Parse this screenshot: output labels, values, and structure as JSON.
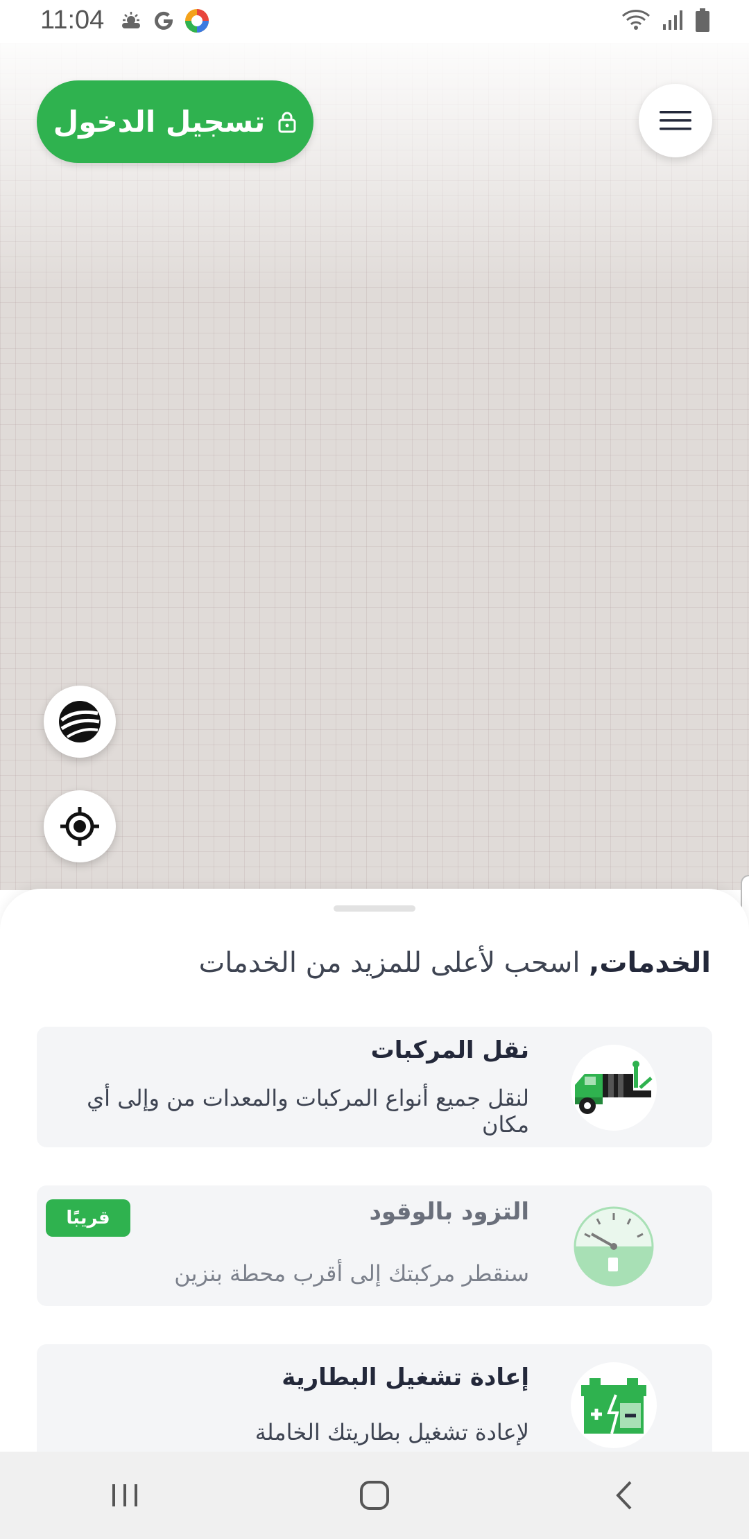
{
  "status_bar": {
    "time": "11:04",
    "left_icons": [
      "weather-icon",
      "google-icon",
      "app-icon"
    ],
    "right_icons": [
      "wifi-icon",
      "signal-icon",
      "battery-icon"
    ]
  },
  "header": {
    "login_label": "تسجيل الدخول",
    "login_icon": "lock-icon",
    "menu_icon": "hamburger-menu-icon"
  },
  "map": {
    "controls": [
      "map-layers-icon",
      "my-location-icon"
    ]
  },
  "sheet": {
    "title_bold": "الخدمات,",
    "title_rest": " اسحب لأعلى للمزيد من الخدمات",
    "services": [
      {
        "title": "نقل المركبات",
        "description": "لنقل جميع أنواع المركبات والمعدات من وإلى أي مكان",
        "icon": "tow-truck-icon"
      },
      {
        "title": "التزود بالوقود",
        "description": "سنقطر مركبتك إلى أقرب محطة بنزين",
        "icon": "fuel-gauge-icon",
        "badge": "قريبًا"
      },
      {
        "title": "إعادة تشغيل البطارية",
        "description": "لإعادة تشغيل بطاريتك الخاملة",
        "icon": "battery-jump-icon"
      }
    ]
  },
  "colors": {
    "brand_green": "#2fb24f",
    "title_text": "#23283a",
    "card_bg": "#f4f5f7"
  },
  "nav_bar": [
    "recent-apps-icon",
    "home-icon",
    "back-icon"
  ]
}
